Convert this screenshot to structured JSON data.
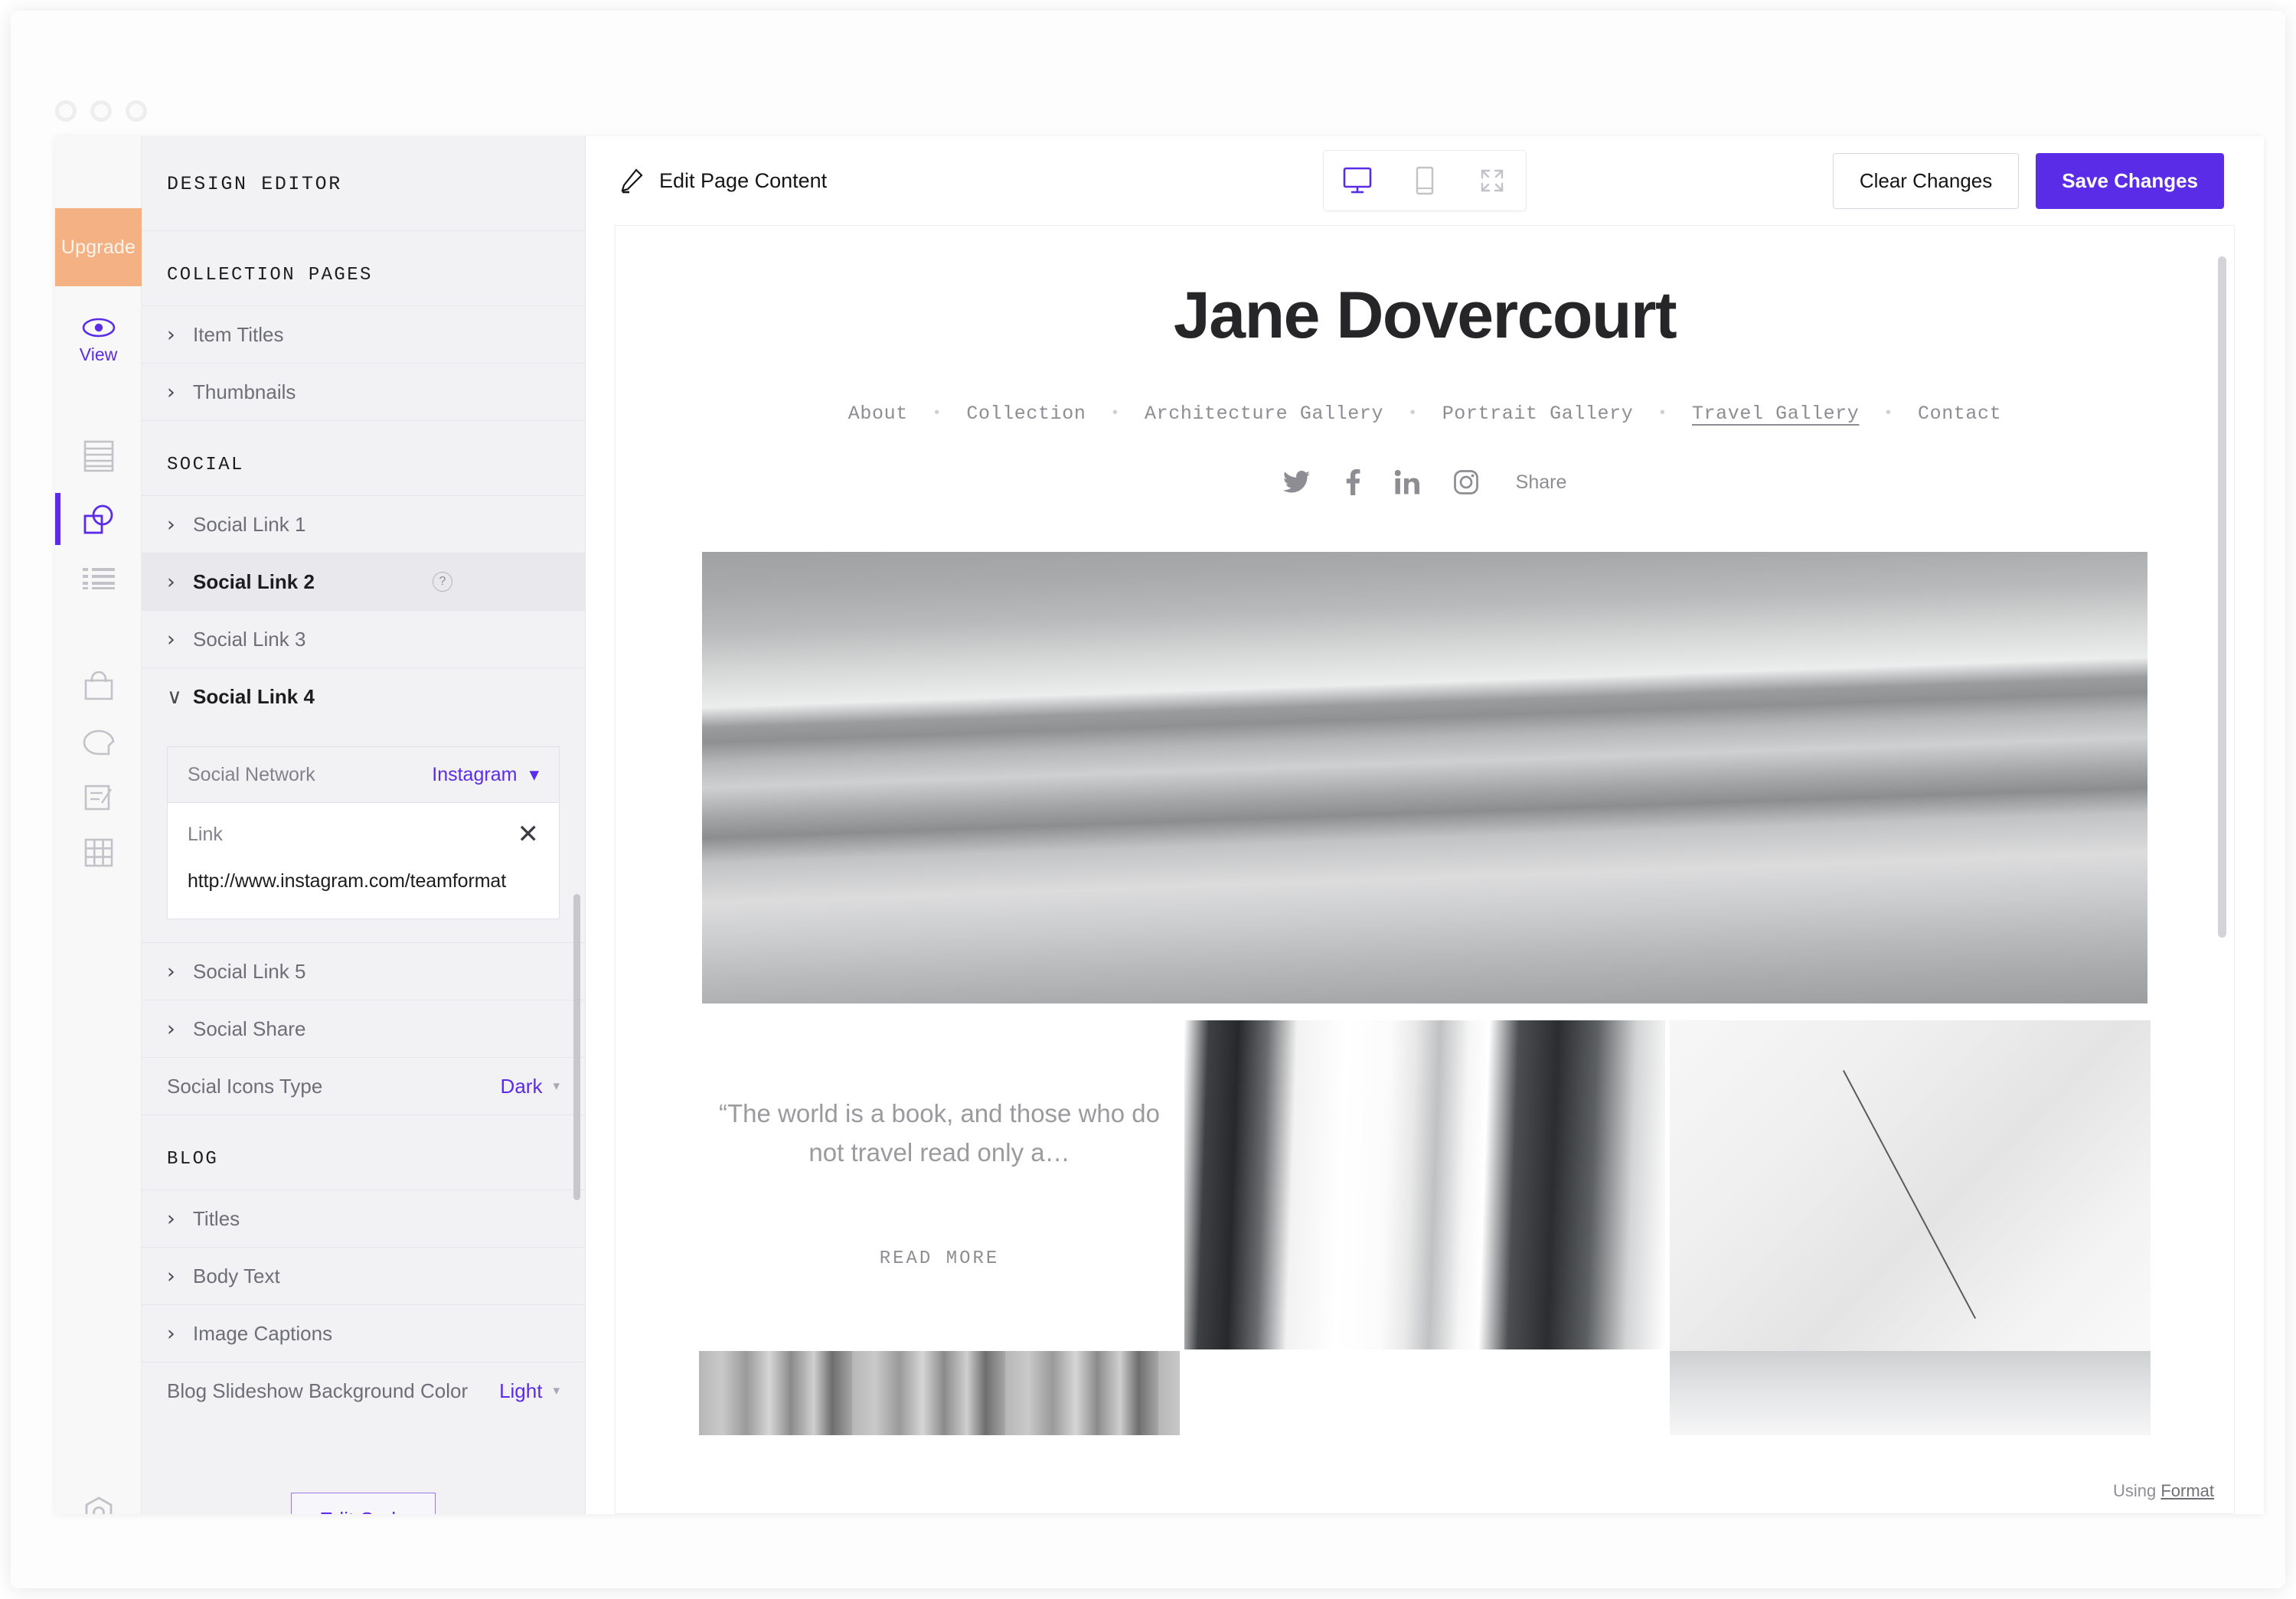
{
  "window": {
    "controls": [
      "close",
      "minimize",
      "maximize"
    ]
  },
  "rail": {
    "hamburger_icon": "hamburger-icon",
    "upgrade_label": "Upgrade",
    "view_label": "View",
    "view_icon": "eye-icon",
    "items": [
      {
        "name": "pages",
        "icon": "pages-icon"
      },
      {
        "name": "design",
        "icon": "design-shapes-icon",
        "active": true
      },
      {
        "name": "lists",
        "icon": "list-icon"
      },
      {
        "name": "store",
        "icon": "shopping-bag-icon"
      },
      {
        "name": "chat",
        "icon": "chat-bubble-icon"
      },
      {
        "name": "blog",
        "icon": "blog-edit-icon"
      },
      {
        "name": "grid",
        "icon": "grid-icon"
      },
      {
        "name": "settings",
        "icon": "gear-icon"
      },
      {
        "name": "help",
        "icon": "question-mark-icon"
      }
    ]
  },
  "panel": {
    "title": "DESIGN EDITOR",
    "sections": [
      {
        "heading": "COLLECTION PAGES",
        "rows": [
          {
            "label": "Item Titles",
            "type": "expandable"
          },
          {
            "label": "Thumbnails",
            "type": "expandable"
          }
        ]
      },
      {
        "heading": "SOCIAL",
        "rows": [
          {
            "label": "Social Link 1",
            "type": "expandable"
          },
          {
            "label": "Social Link 2",
            "type": "expandable",
            "help": "?",
            "active": true
          },
          {
            "label": "Social Link 3",
            "type": "expandable"
          },
          {
            "label": "Social Link 4",
            "type": "expanded"
          },
          {
            "label": "Social Link 5",
            "type": "expandable"
          },
          {
            "label": "Social Share",
            "type": "expandable"
          },
          {
            "label": "Social Icons Type",
            "type": "select",
            "value": "Dark"
          }
        ]
      },
      {
        "heading": "BLOG",
        "rows": [
          {
            "label": "Titles",
            "type": "expandable"
          },
          {
            "label": "Body Text",
            "type": "expandable"
          },
          {
            "label": "Image Captions",
            "type": "expandable"
          },
          {
            "label": "Blog Slideshow Background Color",
            "type": "select",
            "value": "Light"
          }
        ]
      }
    ],
    "social_link_4": {
      "network_label": "Social Network",
      "network_value": "Instagram",
      "link_label": "Link",
      "link_value": "http://www.instagram.com/teamformat",
      "clear_icon": "close-icon"
    },
    "edit_code_label": "Edit Code",
    "row_labels": {
      "item_titles": "Item Titles",
      "thumbnails": "Thumbnails",
      "social_link_1": "Social Link 1",
      "social_link_2": "Social Link 2",
      "social_link_3": "Social Link 3",
      "social_link_4": "Social Link 4",
      "social_link_5": "Social Link 5",
      "social_share": "Social Share",
      "social_icons_type": "Social Icons Type",
      "social_icons_value": "Dark",
      "titles": "Titles",
      "body_text": "Body Text",
      "image_captions": "Image Captions",
      "blog_bg": "Blog Slideshow Background Color",
      "blog_bg_value": "Light"
    },
    "headings": {
      "collection_pages": "COLLECTION PAGES",
      "social": "SOCIAL",
      "blog": "BLOG"
    },
    "help_badge": "?",
    "chevron_right": "›",
    "chevron_down": "∨",
    "caret": "▾"
  },
  "toolbar": {
    "edit_page_content_label": "Edit Page Content",
    "pencil_icon": "pencil-icon",
    "devices": [
      {
        "name": "desktop",
        "icon": "desktop-icon",
        "active": true
      },
      {
        "name": "mobile",
        "icon": "mobile-icon",
        "active": false
      },
      {
        "name": "fullscreen",
        "icon": "expand-icon",
        "active": false
      }
    ],
    "clear_changes_label": "Clear Changes",
    "save_changes_label": "Save Changes"
  },
  "preview": {
    "site_title": "Jane Dovercourt",
    "nav": [
      {
        "label": "About",
        "current": false
      },
      {
        "label": "Collection",
        "current": false
      },
      {
        "label": "Architecture Gallery",
        "current": false
      },
      {
        "label": "Portrait Gallery",
        "current": false
      },
      {
        "label": "Travel Gallery",
        "current": true
      },
      {
        "label": "Contact",
        "current": false
      }
    ],
    "nav_separator": "•",
    "social_icons": [
      {
        "name": "twitter-icon"
      },
      {
        "name": "facebook-icon"
      },
      {
        "name": "linkedin-icon"
      },
      {
        "name": "instagram-icon"
      }
    ],
    "share_label": "Share",
    "quote": "“The world is a book, and those who do not travel read only a…",
    "read_more_label": "READ MORE",
    "footer_prefix": "Using ",
    "footer_link": "Format"
  },
  "colors": {
    "accent_purple": "#5B2CE8",
    "upgrade_peach": "#F4B183",
    "panel_bg": "#F2F2F4",
    "rail_bg": "#F8F8F9",
    "muted_text": "#8D8D93"
  }
}
